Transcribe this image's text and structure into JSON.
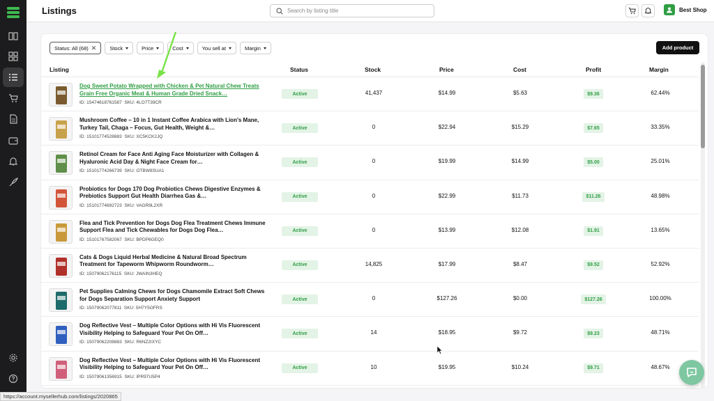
{
  "header": {
    "title": "Listings",
    "search_placeholder": "Search by listing title",
    "shop_name": "Best Shop"
  },
  "filters": {
    "status": "Status: All (68)",
    "stock": "Stock",
    "price": "Price",
    "cost": "Cost",
    "you_sell_at": "You sell at",
    "margin": "Margin"
  },
  "add_product_label": "Add product",
  "columns": {
    "listing": "Listing",
    "status": "Status",
    "stock": "Stock",
    "price": "Price",
    "cost": "Cost",
    "profit": "Profit",
    "margin": "Margin"
  },
  "rows": [
    {
      "title": "Dog Sweet Potato Wrapped with Chicken & Pet Natural Chew Treats Grain Free Organic Meat & Human Grade Dried Snack…",
      "id": "ID: 15474618761587",
      "sku": "SKU: 4LO7T39CR",
      "status": "Active",
      "stock": "41,437",
      "price": "$14.99",
      "cost": "$5.63",
      "profit": "$9.36",
      "margin": "62.44%",
      "thumb_color": "#7a5a2e"
    },
    {
      "title": "Mushroom Coffee – 10 in 1 Instant Coffee Arabica with Lion's Mane, Turkey Tail, Chaga – Focus, Gut Health, Weight &…",
      "id": "ID: 15101774528883",
      "sku": "SKU: XC5KCK2JQ",
      "status": "Active",
      "stock": "0",
      "price": "$22.94",
      "cost": "$15.29",
      "profit": "$7.65",
      "margin": "33.35%",
      "thumb_color": "#c8a24a"
    },
    {
      "title": "Retinol Cream for Face Anti Aging Face Moisturizer with Collagen & Hyaluronic Acid Day & Night Face Cream for…",
      "id": "ID: 15101774266739",
      "sku": "SKU: OTBW8SUA1",
      "status": "Active",
      "stock": "0",
      "price": "$19.99",
      "cost": "$14.99",
      "profit": "$5.00",
      "margin": "25.01%",
      "thumb_color": "#5f8f4a"
    },
    {
      "title": "Probiotics for Dogs 170 Dog Probiotics Chews Digestive Enzymes & Prebiotics Support Gut Health Diarrhea Gas &…",
      "id": "ID: 15101774692723",
      "sku": "SKU: VAGR9L2XR",
      "status": "Active",
      "stock": "0",
      "price": "$22.99",
      "cost": "$11.73",
      "profit": "$11.26",
      "margin": "48.98%",
      "thumb_color": "#d2553a"
    },
    {
      "title": "Flea and Tick Prevention for Dogs Dog Flea Treatment Chews Immune Support Flea and Tick Chewables for Dogs Dog Flea…",
      "id": "ID: 15101767582067",
      "sku": "SKU: BPDP6GEQ0",
      "status": "Active",
      "stock": "0",
      "price": "$13.99",
      "cost": "$12.08",
      "profit": "$1.91",
      "margin": "13.65%",
      "thumb_color": "#c89a3a"
    },
    {
      "title": "Cats & Dogs Liquid Herbal Medicine & Natural Broad Spectrum Treatment for Tapeworm Whipworm Roundworm…",
      "id": "ID: 15079062176115",
      "sku": "SKU: JWAIN3HEQ",
      "status": "Active",
      "stock": "14,825",
      "price": "$17.99",
      "cost": "$8.47",
      "profit": "$9.52",
      "margin": "52.92%",
      "thumb_color": "#b0302a"
    },
    {
      "title": "Pet Supplies Calming Chews for Dogs Chamomile Extract Soft Chews for Dogs Separation Support Anxiety Support",
      "id": "ID: 15079062077811",
      "sku": "SKU: 5H7Y5OFRS",
      "status": "Active",
      "stock": "0",
      "price": "$127.26",
      "cost": "$0.00",
      "profit": "$127.26",
      "margin": "100.00%",
      "thumb_color": "#1f6b6b"
    },
    {
      "title": "Dog Reflective Vest – Multiple Color Options with Hi Vis Fluorescent Visibility Helping to Safeguard Your Pet On Off…",
      "id": "ID: 15079062208883",
      "sku": "SKU: R6NZ2IXYC",
      "status": "Active",
      "stock": "14",
      "price": "$18.95",
      "cost": "$9.72",
      "profit": "$9.23",
      "margin": "48.71%",
      "thumb_color": "#2f5fbf"
    },
    {
      "title": "Dog Reflective Vest – Multiple Color Options with Hi Vis Fluorescent Visibility Helping to Safeguard Your Pet On Off…",
      "id": "ID: 15079061356915",
      "sku": "SKU: IPR97U5P4",
      "status": "Active",
      "stock": "10",
      "price": "$19.95",
      "cost": "$10.24",
      "profit": "$9.71",
      "margin": "48.67%",
      "thumb_color": "#d0607a"
    }
  ],
  "status_url": "https://account.mysellerhub.com/listings/2020865",
  "colors": {
    "accent": "#2f9e44",
    "sidebar": "#1c1c1e",
    "arrow": "#7be34a"
  },
  "sidebar_icons": [
    "book-icon",
    "grid-icon",
    "list-icon",
    "cart-icon",
    "document-icon",
    "wallet-icon",
    "bell-icon",
    "rocket-icon",
    "gear-icon",
    "help-icon"
  ]
}
